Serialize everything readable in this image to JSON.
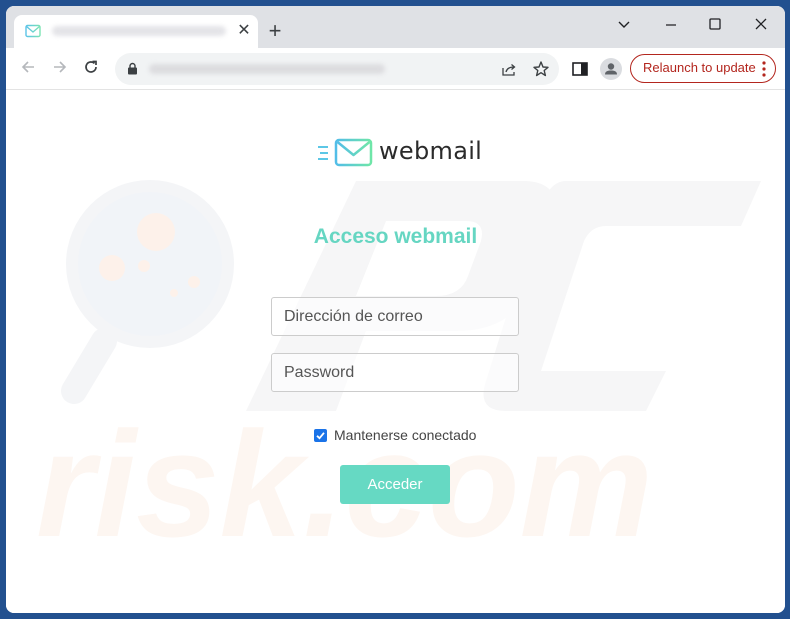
{
  "browser": {
    "tab": {
      "title": "",
      "favicon": "envelope-icon",
      "close_icon": "✕"
    },
    "new_tab_icon": "+",
    "window_controls": {
      "tab_search": "⌄",
      "minimize": "—",
      "maximize": "☐",
      "close": "✕"
    },
    "address_bar": {
      "url": "",
      "lock_icon": "lock-icon"
    },
    "relaunch_label": "Relaunch to update",
    "colors": {
      "relaunch": "#b3261e",
      "frame": "#dfe1e5",
      "desktop": "#22508f"
    }
  },
  "page": {
    "logo": {
      "text": "webmail",
      "icon": "envelope-icon"
    },
    "title": "Acceso webmail",
    "email": {
      "placeholder": "Dirección de correo",
      "value": ""
    },
    "password": {
      "placeholder": "Password",
      "value": ""
    },
    "remember": {
      "label": "Mantenerse conectado",
      "checked": true
    },
    "submit_label": "Acceder",
    "colors": {
      "accent": "#66d6c2",
      "button": "#66d9c3",
      "checkbox": "#1a73e8"
    }
  },
  "watermark": {
    "text": "PC risk.com"
  }
}
